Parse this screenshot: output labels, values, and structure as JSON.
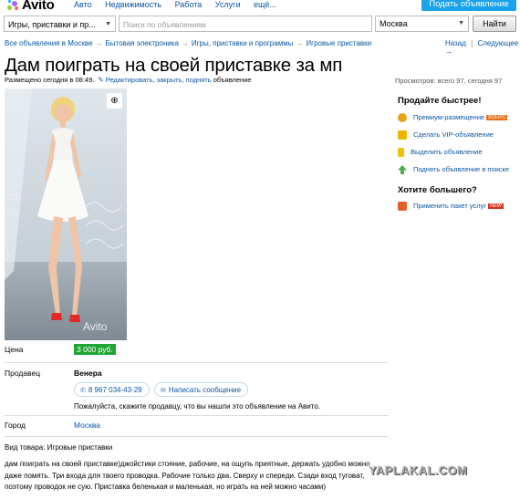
{
  "brand": {
    "logo_text": "Avito"
  },
  "topnav": [
    "Авто",
    "Недвижимость",
    "Работа",
    "Услуги",
    "ещё..."
  ],
  "post_button": "Подать объявление",
  "search": {
    "category": "Игры, приставки и пр...",
    "placeholder": "Поиск по объявлениям",
    "city": "Москва",
    "submit": "Найти"
  },
  "breadcrumbs": [
    "Все объявления в Москве",
    "Бытовая электроника",
    "Игры, приставки и программы",
    "Игровые приставки"
  ],
  "backnav": {
    "back": "Назад",
    "next": "Следующее →"
  },
  "listing": {
    "title": "Дам поиграть на своей приставке за мп",
    "posted": "Размещено сегодня в 08:49.",
    "edit_link": "✎ Редактировать, закрыть, поднять",
    "edit_suffix": "объявление",
    "views": "Просмотров: всего 97, сегодня 97",
    "photo_watermark": "Avito",
    "price_label": "Цена",
    "price": "3 000 руб.",
    "seller_label": "Продавец",
    "seller_name": "Венера",
    "phone": "8 967 034-43-29",
    "message_button": "Написать сообщение",
    "hint": "Пожалуйста, скажите продавцу, что вы нашли это объявление на Авито.",
    "city_label": "Город",
    "city": "Москва",
    "kind": "Вид товара: Игровые приставки",
    "description": "дам поиграть на своей приставке)джойстики стояние, рабочие, на ощупь приятные, держать удобно можно даже помять. Три входа для твоего проводка. Рабочие только два. Сверху и спереди. Сзади вход туговат, поэтому проводок не сую. Приставка беленькая и маленькая, но играть на ней можно часами)"
  },
  "sidebar": {
    "sell_faster": "Продайте быстрее!",
    "items": [
      {
        "label": "Премиум-размещение",
        "badge": "БОНУС",
        "icon": "coin-icon",
        "color": "#e8a317"
      },
      {
        "label": "Сделать VIP-объявление",
        "icon": "star-icon",
        "color": "#f0b400"
      },
      {
        "label": "Выделить объявление",
        "icon": "highlighter-icon",
        "color": "#f2c200"
      },
      {
        "label": "Поднять объявление в поиске",
        "icon": "arrow-up-icon",
        "color": "#4caf50"
      }
    ],
    "want_more": "Хотите большего?",
    "package": {
      "label": "Применить пакет услуг",
      "badge": "NEW",
      "icon": "gift-icon",
      "color": "#e85d2a"
    }
  },
  "site_watermark": "YAPLAKAL.COM",
  "colors": {
    "link": "#0b57a3",
    "price_bg": "#20a535",
    "post_button": "#1aa3ea"
  }
}
